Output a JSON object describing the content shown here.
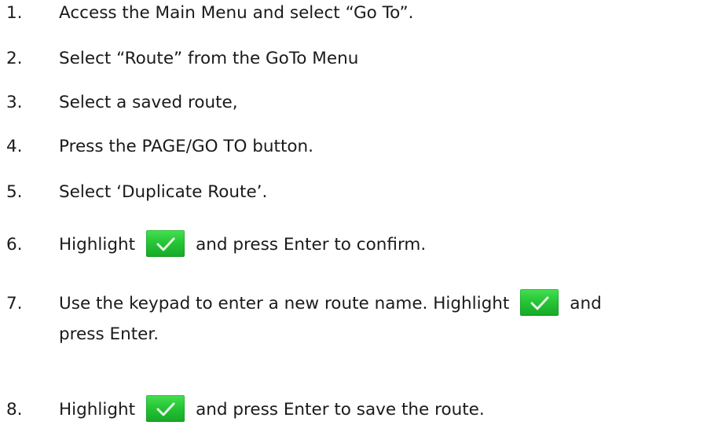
{
  "steps": [
    {
      "num": "1.",
      "text": "Access the Main Menu and select “Go To”."
    },
    {
      "num": "2.",
      "text": "Select “Route” from the GoTo Menu"
    },
    {
      "num": "3.",
      "text": "Select a saved route,"
    },
    {
      "num": "4.",
      "text": "Press the PAGE/GO TO button."
    },
    {
      "num": "5.",
      "text": "Select ‘Duplicate Route’."
    },
    {
      "num": "6.",
      "before": "Highlight",
      "after": "and press Enter to confirm."
    },
    {
      "num": "7.",
      "before": "Use the keypad to enter a new route name. Highlight",
      "after": "and",
      "line2": "press Enter."
    },
    {
      "num": "8.",
      "before": "Highlight",
      "after": "and press Enter to save the route."
    }
  ],
  "check_button": {
    "icon": "checkmark-icon",
    "color": "#27c637",
    "check_color": "#e6f7e6"
  }
}
